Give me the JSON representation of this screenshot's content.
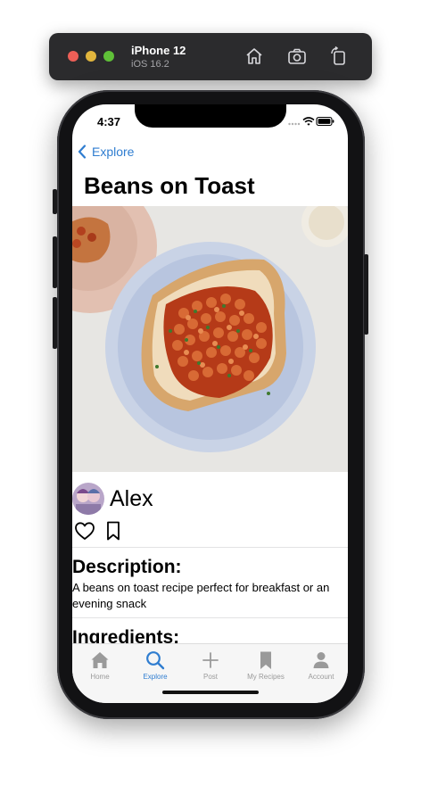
{
  "simulator": {
    "device_name": "iPhone 12",
    "os_version": "iOS 16.2",
    "icons": [
      "home-icon",
      "screenshot-icon",
      "rotate-icon"
    ]
  },
  "status_bar": {
    "time": "4:37"
  },
  "nav": {
    "back_label": "Explore"
  },
  "recipe": {
    "title": "Beans on Toast",
    "author": "Alex",
    "description_heading": "Description:",
    "description": "A beans on toast recipe perfect for breakfast or an evening snack",
    "ingredients_heading": "Ingredients:"
  },
  "tabbar": {
    "tabs": [
      {
        "label": "Home",
        "icon": "home-icon",
        "active": false
      },
      {
        "label": "Explore",
        "icon": "search-icon",
        "active": true
      },
      {
        "label": "Post",
        "icon": "plus-icon",
        "active": false
      },
      {
        "label": "My Recipes",
        "icon": "bookmark-icon",
        "active": false
      },
      {
        "label": "Account",
        "icon": "person-icon",
        "active": false
      }
    ]
  },
  "colors": {
    "accent": "#2f7dd0",
    "tab_inactive": "#9a9a9a",
    "toolbar_bg": "#2b2b2d"
  }
}
